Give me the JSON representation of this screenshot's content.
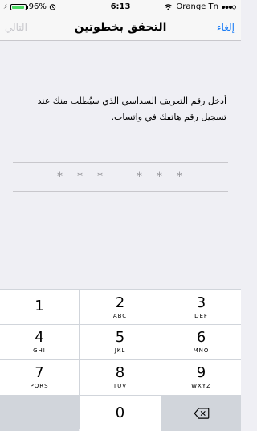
{
  "status": {
    "charging_symbol": "⚡",
    "battery": "96%",
    "time": "6:13",
    "carrier": "Orange Tn"
  },
  "nav": {
    "title": "التحقق بخطوتين",
    "next": "التالي",
    "cancel": "إلغاء"
  },
  "instruction": "أدخل رقم التعريف السداسي الذي سيُطلب منك عند تسجيل رقم هاتفك في واتساب.",
  "code_placeholder": [
    "*",
    "*",
    "*",
    "*",
    "*",
    "*"
  ],
  "keypad": [
    {
      "num": "1",
      "letters": ""
    },
    {
      "num": "2",
      "letters": "ABC"
    },
    {
      "num": "3",
      "letters": "DEF"
    },
    {
      "num": "4",
      "letters": "GHI"
    },
    {
      "num": "5",
      "letters": "JKL"
    },
    {
      "num": "6",
      "letters": "MNO"
    },
    {
      "num": "7",
      "letters": "PQRS"
    },
    {
      "num": "8",
      "letters": "TUV"
    },
    {
      "num": "9",
      "letters": "WXYZ"
    },
    {
      "num": "0",
      "letters": ""
    }
  ],
  "colors": {
    "link": "#1a7cf5",
    "battery_fill": "#4cd964"
  }
}
